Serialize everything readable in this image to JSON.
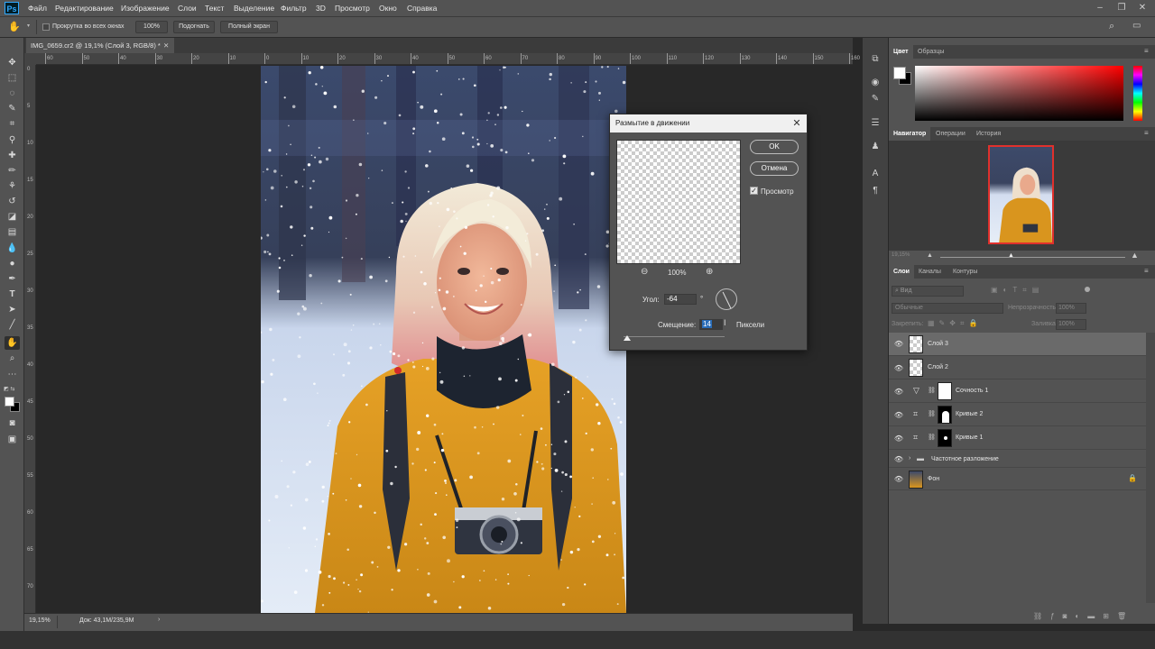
{
  "app": {
    "logo": "Ps"
  },
  "menu": [
    "Файл",
    "Редактирование",
    "Изображение",
    "Слои",
    "Текст",
    "Выделение",
    "Фильтр",
    "3D",
    "Просмотр",
    "Окно",
    "Справка"
  ],
  "options": {
    "scroll_all_label": "Прокрутка во всех окнах",
    "zoom_value": "100%",
    "fit_label": "Подогнать",
    "fullscreen_label": "Полный экран"
  },
  "document": {
    "tab_title": "IMG_0659.cr2 @ 19,1% (Слой 3, RGB/8) *"
  },
  "ruler": {
    "h_ticks": [
      "60",
      "50",
      "40",
      "30",
      "20",
      "10",
      "0",
      "10",
      "20",
      "30",
      "40",
      "50",
      "60",
      "70",
      "80",
      "90",
      "100",
      "110",
      "120",
      "130",
      "140",
      "150",
      "160"
    ],
    "v_ticks": [
      "0",
      "5",
      "10",
      "15",
      "20",
      "25",
      "30",
      "35",
      "40",
      "45",
      "50",
      "55",
      "60",
      "65",
      "70"
    ]
  },
  "status": {
    "zoom": "19,15%",
    "doc_size": "Док: 43,1M/235,9M"
  },
  "color_panel": {
    "tabs": [
      "Цвет",
      "Образцы"
    ],
    "hue_color": "#ff0000"
  },
  "navigator": {
    "tabs": [
      "Навигатор",
      "Операции",
      "История"
    ],
    "zoom": "19,15%"
  },
  "layers_panel": {
    "tabs": [
      "Слои",
      "Каналы",
      "Контуры"
    ],
    "filter_placeholder": "Вид",
    "blend_mode": "Обычные",
    "opacity_label": "Непрозрачность:",
    "opacity_value": "100%",
    "lock_label": "Закрепить:",
    "fill_label": "Заливка:",
    "fill_value": "100%",
    "layers": [
      {
        "name": "Слой 3"
      },
      {
        "name": "Слой 2"
      },
      {
        "name": "Сочность 1"
      },
      {
        "name": "Кривые 2"
      },
      {
        "name": "Кривые 1"
      },
      {
        "name": "Частотное разложение"
      },
      {
        "name": "Фон"
      }
    ]
  },
  "dialog": {
    "title": "Размытие в движении",
    "ok_label": "OK",
    "cancel_label": "Отмена",
    "preview_label": "Просмотр",
    "preview_checked": true,
    "zoom_value": "100%",
    "angle_label": "Угол:",
    "angle_value": "-64",
    "angle_unit": "°",
    "offset_label": "Смещение:",
    "offset_value": "14",
    "offset_unit": "Пиксели"
  }
}
